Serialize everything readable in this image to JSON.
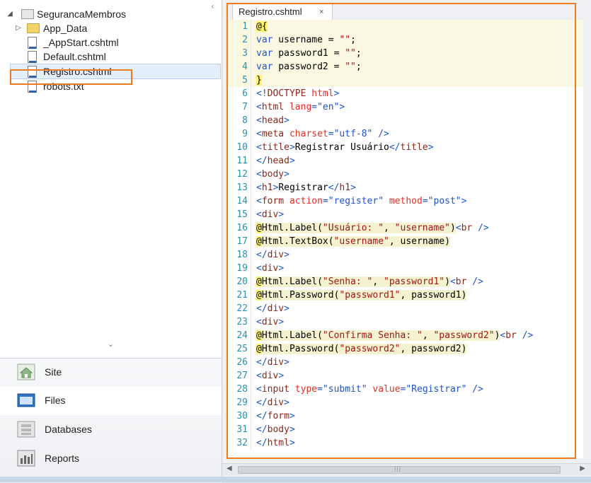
{
  "tree": {
    "root": "SegurancaMembros",
    "items": [
      {
        "label": "App_Data",
        "type": "folder"
      },
      {
        "label": "_AppStart.cshtml",
        "type": "file"
      },
      {
        "label": "Default.cshtml",
        "type": "file"
      },
      {
        "label": "Registro.cshtml",
        "type": "file",
        "selected": true
      },
      {
        "label": "robots.txt",
        "type": "file"
      }
    ]
  },
  "nav": {
    "items": [
      {
        "label": "Site",
        "icon": "home-icon"
      },
      {
        "label": "Files",
        "icon": "files-icon",
        "active": true
      },
      {
        "label": "Databases",
        "icon": "database-icon"
      },
      {
        "label": "Reports",
        "icon": "reports-icon"
      }
    ]
  },
  "editor": {
    "tab_label": "Registro.cshtml",
    "tab_close": "×",
    "line_numbers": [
      "1",
      "2",
      "3",
      "4",
      "5",
      "6",
      "7",
      "8",
      "9",
      "10",
      "11",
      "12",
      "13",
      "14",
      "15",
      "16",
      "17",
      "18",
      "19",
      "20",
      "21",
      "22",
      "23",
      "24",
      "25",
      "26",
      "27",
      "28",
      "29",
      "30",
      "31",
      "32"
    ]
  },
  "colors": {
    "highlight_border": "#f07a1e",
    "razor_block_bg": "#fbf8e2",
    "line_number": "#2b91af"
  }
}
